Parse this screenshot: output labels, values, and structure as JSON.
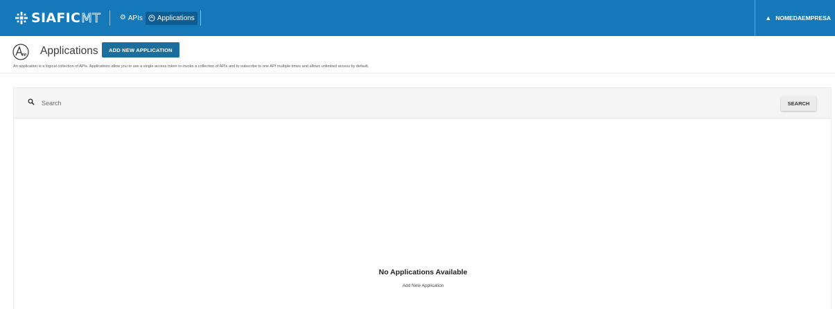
{
  "brand": {
    "name": "SIAFIC",
    "suffix": "MT"
  },
  "nav": [
    {
      "label": "APIs",
      "icon": "gear-icon"
    },
    {
      "label": "Applications",
      "icon": "applications-icon",
      "active": true
    }
  ],
  "user": {
    "label": "NOMEDAEMPRESA",
    "icon": "user-icon"
  },
  "header": {
    "icon_text": "App",
    "title": "Applications",
    "add_button": "ADD NEW APPLICATION",
    "description": "An application is a logical collection of APIs. Applications allow you to use a single access token to invoke a collection of APIs and to subscribe to one API multiple times and allows unlimited access by default."
  },
  "search": {
    "placeholder": "Search",
    "value": "",
    "button": "SEARCH"
  },
  "empty_state": {
    "title": "No Applications Available",
    "link": "Add New Application"
  },
  "colors": {
    "topbar": "#1478b9",
    "primary_button": "#1b6f9c"
  }
}
